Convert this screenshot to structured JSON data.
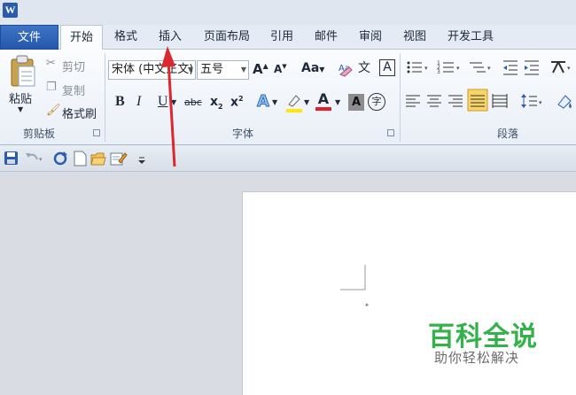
{
  "app": {
    "logo_letter": "W"
  },
  "tabs": {
    "file": "文件",
    "home": "开始",
    "format": "格式",
    "insert": "插入",
    "page_layout": "页面布局",
    "references": "引用",
    "mailings": "邮件",
    "review": "审阅",
    "view": "视图",
    "developer": "开发工具"
  },
  "clipboard": {
    "paste": "粘贴",
    "cut": "剪切",
    "copy": "复制",
    "format_painter": "格式刷",
    "group_label": "剪贴板"
  },
  "font": {
    "font_name": "宋体 (中文正文)",
    "font_size": "五号",
    "grow": "A",
    "shrink": "A",
    "case": "Aa",
    "phonetic": "文",
    "border_char": "A",
    "bold": "B",
    "italic": "I",
    "underline": "U",
    "strike": "abc",
    "subscript": "x",
    "superscript": "x",
    "text_effect": "A",
    "font_color": "A",
    "shading_char": "A",
    "enclose_char": "字",
    "group_label": "字体"
  },
  "paragraph": {
    "group_label": "段落"
  },
  "colors": {
    "accent": "#2a5caa",
    "highlight": "#ffe800",
    "font_color": "#e0202a",
    "watermark_green": "#33b24a",
    "arrow_red": "#d9282f"
  },
  "watermark": {
    "title": "百科全说",
    "subtitle": "助你轻松解决"
  }
}
